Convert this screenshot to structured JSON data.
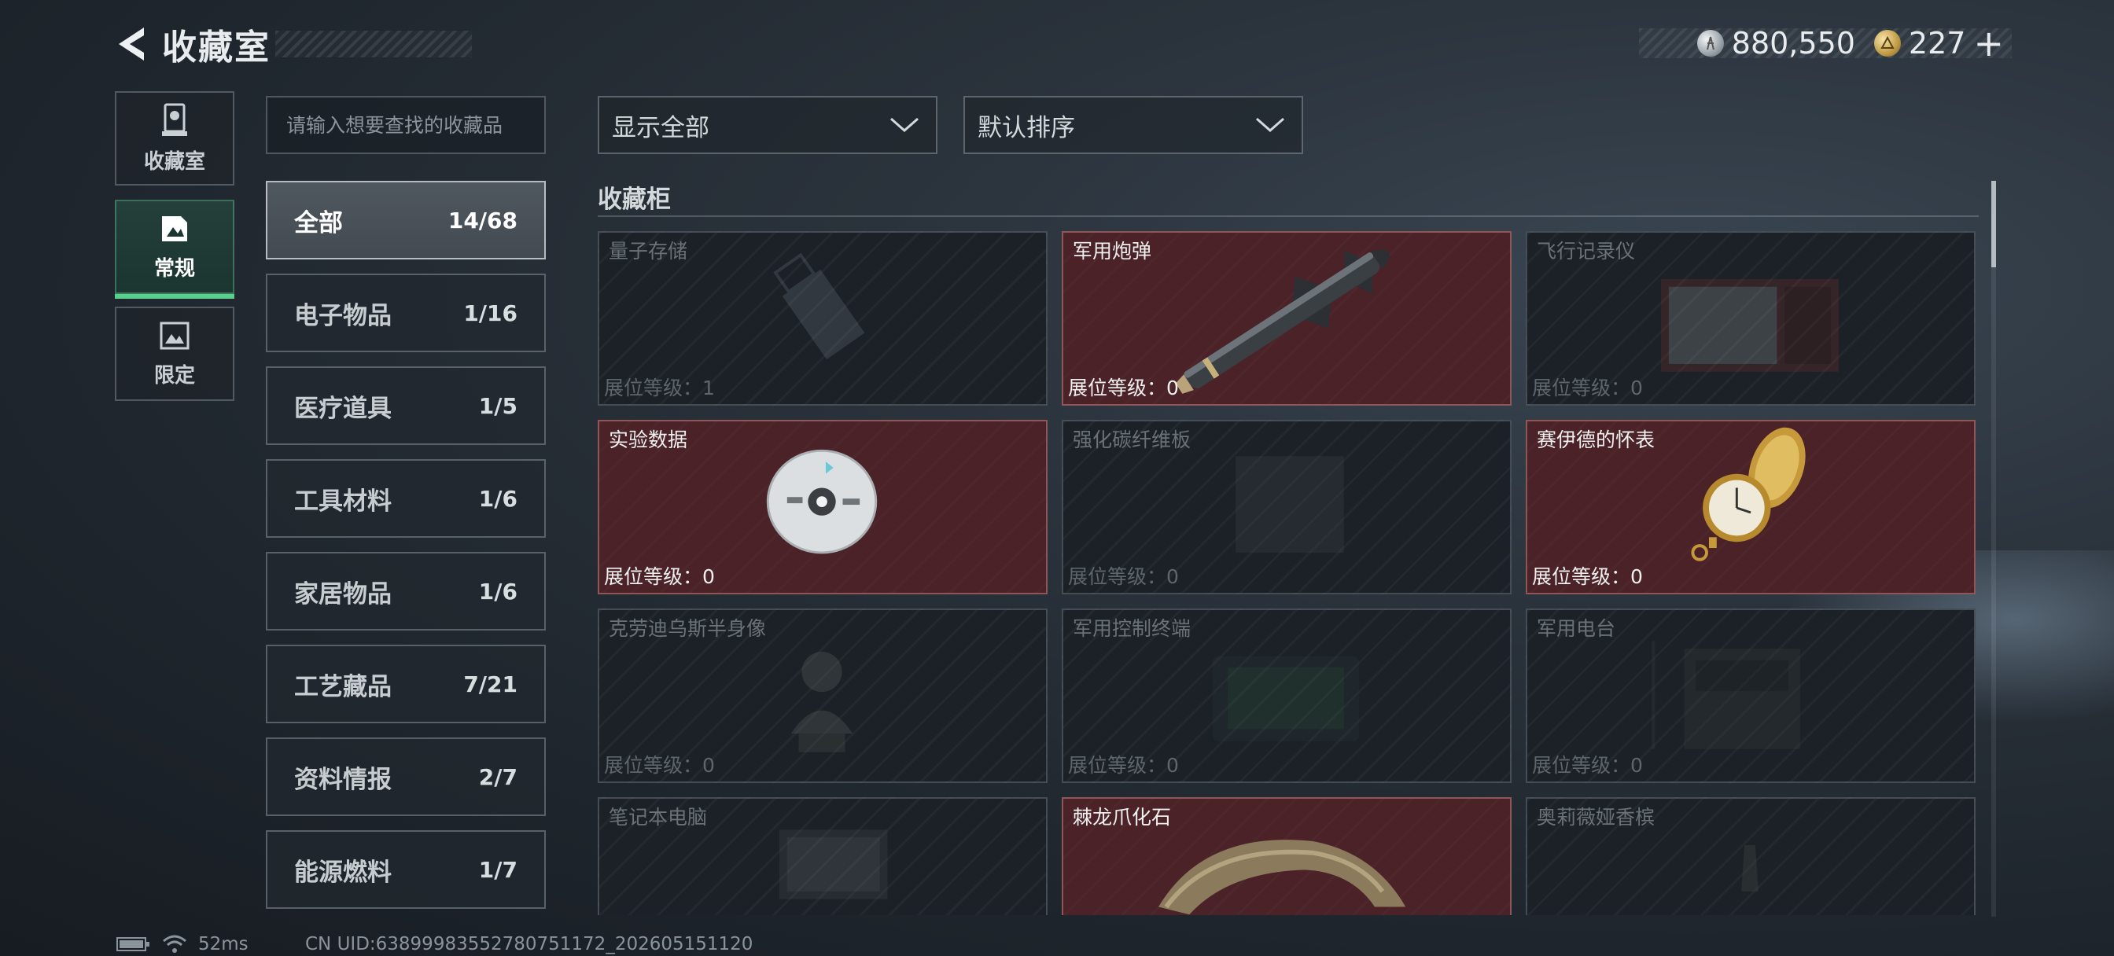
{
  "header": {
    "title": "收藏室",
    "currencies": [
      {
        "icon": "silver-coin-icon",
        "value": "880,550"
      },
      {
        "icon": "gold-triangle-coin-icon",
        "value": "227"
      }
    ],
    "add_label": "+"
  },
  "side_tabs": [
    {
      "label": "收藏室",
      "icon": "trophy-icon",
      "active": false
    },
    {
      "label": "常规",
      "icon": "document-icon",
      "active": true
    },
    {
      "label": "限定",
      "icon": "image-icon",
      "active": false
    }
  ],
  "search": {
    "placeholder": "请输入想要查找的收藏品",
    "value": ""
  },
  "categories": [
    {
      "name": "全部",
      "count": "14/68",
      "active": true
    },
    {
      "name": "电子物品",
      "count": "1/16"
    },
    {
      "name": "医疗道具",
      "count": "1/5"
    },
    {
      "name": "工具材料",
      "count": "1/6"
    },
    {
      "name": "家居物品",
      "count": "1/6"
    },
    {
      "name": "工艺藏品",
      "count": "7/21"
    },
    {
      "name": "资料情报",
      "count": "2/7"
    },
    {
      "name": "能源燃料",
      "count": "1/7"
    }
  ],
  "filters": {
    "display": "显示全部",
    "sort": "默认排序"
  },
  "section_title": "收藏柜",
  "level_label": "展位等级：",
  "items": [
    {
      "name": "量子存储",
      "level": "1",
      "owned": false,
      "art": "usb"
    },
    {
      "name": "军用炮弹",
      "level": "0",
      "owned": true,
      "art": "missile"
    },
    {
      "name": "飞行记录仪",
      "level": "0",
      "owned": false,
      "art": "box"
    },
    {
      "name": "实验数据",
      "level": "0",
      "owned": true,
      "art": "disc"
    },
    {
      "name": "强化碳纤维板",
      "level": "0",
      "owned": false,
      "art": "plate"
    },
    {
      "name": "赛伊德的怀表",
      "level": "0",
      "owned": true,
      "art": "watch"
    },
    {
      "name": "克劳迪乌斯半身像",
      "level": "0",
      "owned": false,
      "art": "bust"
    },
    {
      "name": "军用控制终端",
      "level": "0",
      "owned": false,
      "art": "terminal"
    },
    {
      "name": "军用电台",
      "level": "0",
      "owned": false,
      "art": "radio"
    },
    {
      "name": "笔记本电脑",
      "level": "",
      "owned": false,
      "art": "laptop"
    },
    {
      "name": "棘龙爪化石",
      "level": "",
      "owned": true,
      "art": "claw"
    },
    {
      "name": "奥莉薇娅香槟",
      "level": "",
      "owned": false,
      "art": "bottle"
    }
  ],
  "status_bar": {
    "ping": "52ms",
    "uid": "CN UID:6389998355278075117​2_202605151120"
  },
  "colors": {
    "owned_bg": "#4a2227",
    "active_tab_accent": "#57d08b"
  }
}
